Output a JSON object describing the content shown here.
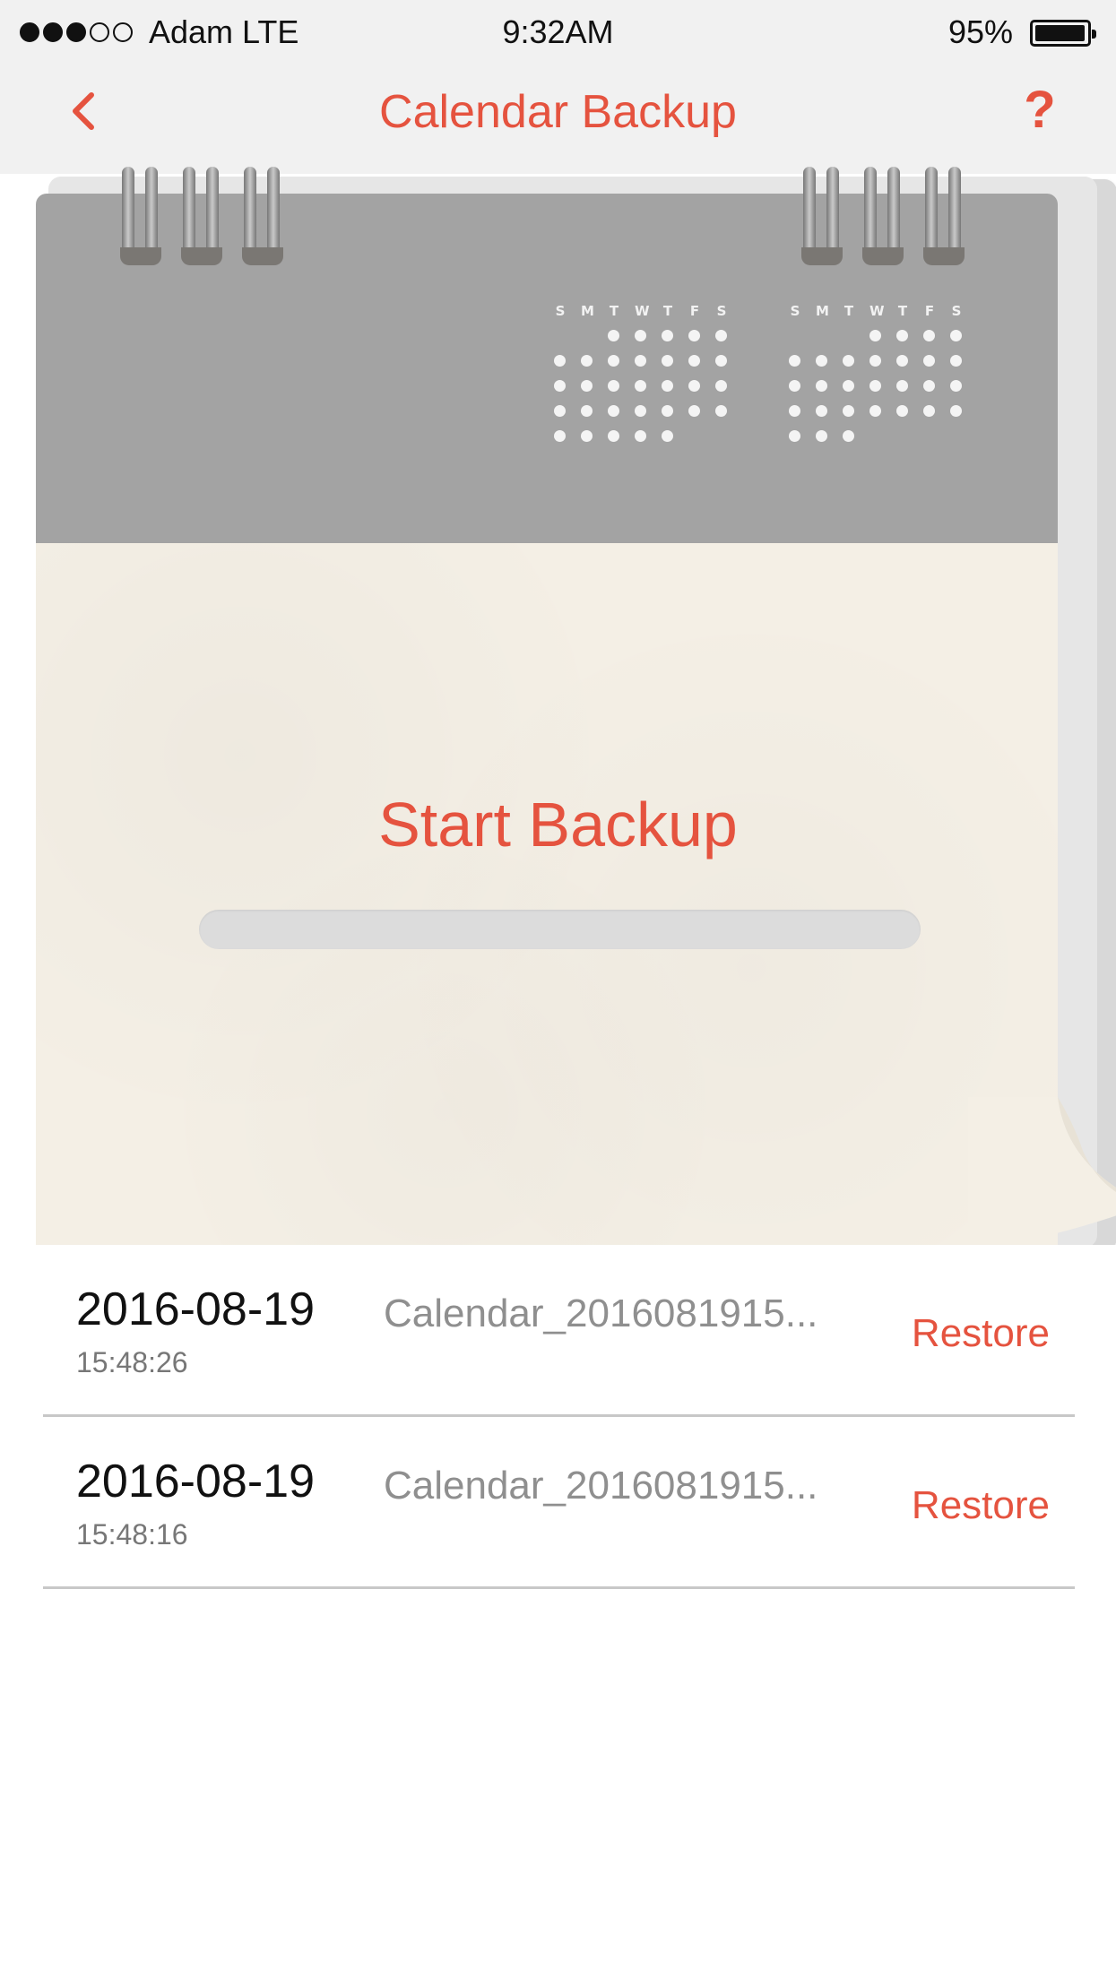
{
  "status_bar": {
    "carrier": "Adam LTE",
    "time": "9:32AM",
    "battery_percent": "95%",
    "signal_bars_filled": 3,
    "signal_bars_total": 5,
    "battery_level": 0.95
  },
  "nav": {
    "title": "Calendar Backup",
    "back_icon": "chevron-left-icon",
    "help_label": "?"
  },
  "calendar_graphic": {
    "weekday_labels_1": [
      "S",
      "M",
      "T",
      "W",
      "T",
      "F",
      "S"
    ],
    "weekday_labels_2": [
      "S",
      "M",
      "T",
      "W",
      "T",
      "F",
      "S"
    ]
  },
  "main": {
    "start_backup_label": "Start Backup",
    "progress": 0
  },
  "backups": [
    {
      "date": "2016-08-19",
      "time": "15:48:26",
      "filename": "Calendar_2016081915...",
      "action": "Restore"
    },
    {
      "date": "2016-08-19",
      "time": "15:48:16",
      "filename": "Calendar_2016081915...",
      "action": "Restore"
    }
  ],
  "colors": {
    "accent": "#e5533f",
    "header_gray": "#a3a3a3",
    "paper": "#f4efe5"
  }
}
